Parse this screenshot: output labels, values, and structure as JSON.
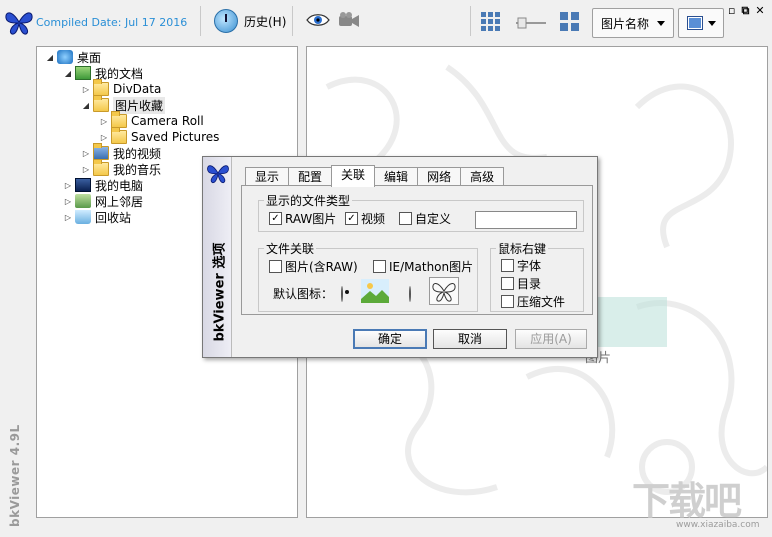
{
  "toolbar": {
    "compiled_date": "Compiled Date: Jul 17 2016",
    "history_label": "历史(H)",
    "sort_label": "图片名称",
    "window_controls": [
      "▫",
      "⧉",
      "✕"
    ]
  },
  "side_label": "bkViewer 4.9L",
  "tree": {
    "items": [
      {
        "label": "桌面",
        "icon": "desktop-icon"
      },
      {
        "label": "我的文档",
        "icon": "documents-icon"
      },
      {
        "label": "DivData",
        "icon": "folder-icon"
      },
      {
        "label": "图片收藏",
        "icon": "pictures-folder-icon"
      },
      {
        "label": "Camera Roll",
        "icon": "folder-icon"
      },
      {
        "label": "Saved Pictures",
        "icon": "folder-icon"
      },
      {
        "label": "我的视频",
        "icon": "video-folder-icon"
      },
      {
        "label": "我的音乐",
        "icon": "music-folder-icon"
      },
      {
        "label": "我的电脑",
        "icon": "computer-icon"
      },
      {
        "label": "网上邻居",
        "icon": "network-icon"
      },
      {
        "label": "回收站",
        "icon": "recycle-bin-icon"
      }
    ]
  },
  "content": {
    "partial_text": "图片"
  },
  "dialog": {
    "side_title": "bkViewer 选项",
    "tabs": [
      "显示",
      "配置",
      "关联",
      "编辑",
      "网络",
      "高级"
    ],
    "active_tab": "关联",
    "filetype_group": {
      "legend": "显示的文件类型",
      "raw": "RAW图片",
      "video": "视频",
      "custom": "自定义",
      "custom_value": ""
    },
    "assoc_group": {
      "legend": "文件关联",
      "pictures": "图片(含RAW)",
      "ie": "IE/Mathon图片",
      "default_icon": "默认图标："
    },
    "rightclick_group": {
      "legend": "鼠标右键",
      "font": "字体",
      "dir": "目录",
      "zip": "压缩文件"
    },
    "buttons": {
      "ok": "确定",
      "cancel": "取消",
      "apply": "应用(A)"
    }
  },
  "watermark": {
    "text": "下载吧",
    "url": "www.xiazaiba.com"
  }
}
